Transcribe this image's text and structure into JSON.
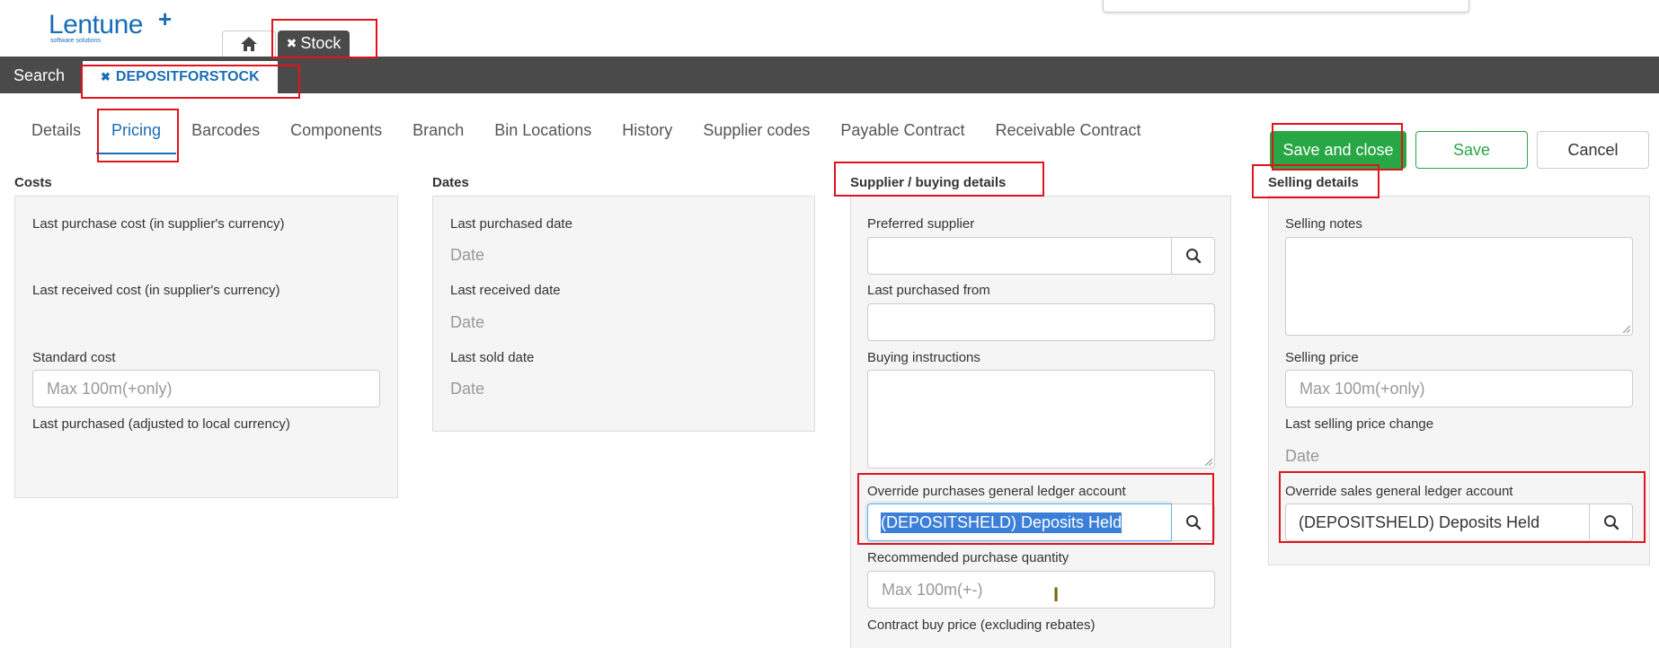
{
  "brand": {
    "name": "Lentune",
    "plus": "+",
    "tagline": "software solutions"
  },
  "app_tabs": {
    "home_icon": "home-icon",
    "stock_close": "✖",
    "stock_label": "Stock"
  },
  "nav": {
    "search_label": "Search",
    "record_close": "✖",
    "record_label": "DEPOSITFORSTOCK"
  },
  "tabs": [
    {
      "label": "Details"
    },
    {
      "label": "Pricing",
      "active": true
    },
    {
      "label": "Barcodes"
    },
    {
      "label": "Components"
    },
    {
      "label": "Branch"
    },
    {
      "label": "Bin Locations"
    },
    {
      "label": "History"
    },
    {
      "label": "Supplier codes"
    },
    {
      "label": "Payable Contract"
    },
    {
      "label": "Receivable Contract"
    }
  ],
  "actions": {
    "save_close": "Save and close",
    "save": "Save",
    "cancel": "Cancel"
  },
  "costs": {
    "title": "Costs",
    "last_purchase_cost": "Last purchase cost (in supplier's currency)",
    "last_received_cost": "Last received cost (in supplier's currency)",
    "standard_cost": "Standard cost",
    "standard_cost_placeholder": "Max 100m(+only)",
    "last_purchased_adjusted": "Last purchased (adjusted to local currency)"
  },
  "dates": {
    "title": "Dates",
    "last_purchased_date": "Last purchased date",
    "last_received_date": "Last received date",
    "last_sold_date": "Last sold date",
    "date_placeholder": "Date"
  },
  "supplier": {
    "title": "Supplier / buying details",
    "preferred_supplier": "Preferred supplier",
    "last_purchased_from": "Last purchased from",
    "buying_instructions": "Buying instructions",
    "override_purchases_gl": "Override purchases general ledger account",
    "override_purchases_gl_value": "(DEPOSITSHELD) Deposits Held",
    "recommended_qty": "Recommended purchase quantity",
    "recommended_qty_placeholder": "Max 100m(+-)",
    "contract_buy_price": "Contract buy price (excluding rebates)"
  },
  "selling": {
    "title": "Selling details",
    "selling_notes": "Selling notes",
    "selling_price": "Selling price",
    "selling_price_placeholder": "Max 100m(+only)",
    "last_selling_price_change": "Last selling price change",
    "date_placeholder": "Date",
    "override_sales_gl": "Override sales general ledger account",
    "override_sales_gl_value": "(DEPOSITSHELD) Deposits Held"
  },
  "colors": {
    "brand_blue": "#1a6db5",
    "nav_dark": "#4a4a4a",
    "success_green": "#28a745",
    "highlight_red": "#e0141c",
    "selection_blue": "#3b7fd9"
  }
}
